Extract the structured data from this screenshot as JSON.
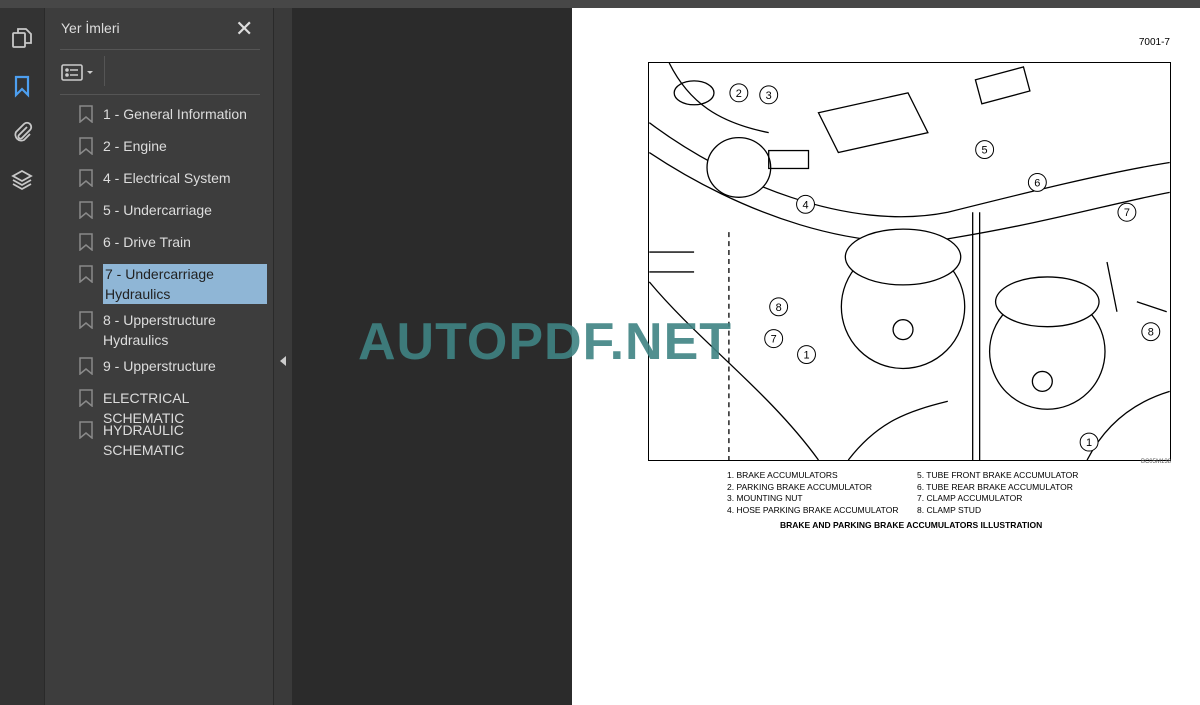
{
  "sidebar": {
    "title": "Yer İmleri",
    "close_icon": "close-icon",
    "rail_icons": [
      "pages-icon",
      "bookmark-icon",
      "attachment-icon",
      "layers-icon"
    ],
    "options_icon": "list-options-icon",
    "bookmarks": [
      {
        "label": "1 - General Information"
      },
      {
        "label": "2 - Engine"
      },
      {
        "label": "4 - Electrical System"
      },
      {
        "label": "5 - Undercarriage"
      },
      {
        "label": "6 - Drive Train"
      },
      {
        "label": "7 - Undercarriage Hydraulics",
        "selected": true
      },
      {
        "label": "8 - Upperstructure Hydraulics"
      },
      {
        "label": "9 - Upperstructure"
      },
      {
        "label": "ELECTRICAL SCHEMATIC"
      },
      {
        "label": "HYDRAULIC SCHEMATIC"
      }
    ]
  },
  "colors": {
    "accent": "#4d9ff0",
    "selection": "#8fb6d6",
    "watermark": "#3f8383"
  },
  "document": {
    "page_number": "7001-7",
    "figure_id": "BC05M138",
    "callouts": [
      "1",
      "2",
      "3",
      "4",
      "5",
      "6",
      "7",
      "8"
    ],
    "legend_left": [
      "1. BRAKE ACCUMULATORS",
      "2. PARKING BRAKE ACCUMULATOR",
      "3. MOUNTING NUT",
      "4. HOSE PARKING BRAKE ACCUMULATOR"
    ],
    "legend_right": [
      "5. TUBE FRONT BRAKE ACCUMULATOR",
      "6. TUBE REAR BRAKE ACCUMULATOR",
      "7. CLAMP ACCUMULATOR",
      "8. CLAMP STUD"
    ],
    "caption": "BRAKE AND PARKING BRAKE ACCUMULATORS ILLUSTRATION",
    "watermark": "AUTOPDF.NET"
  }
}
